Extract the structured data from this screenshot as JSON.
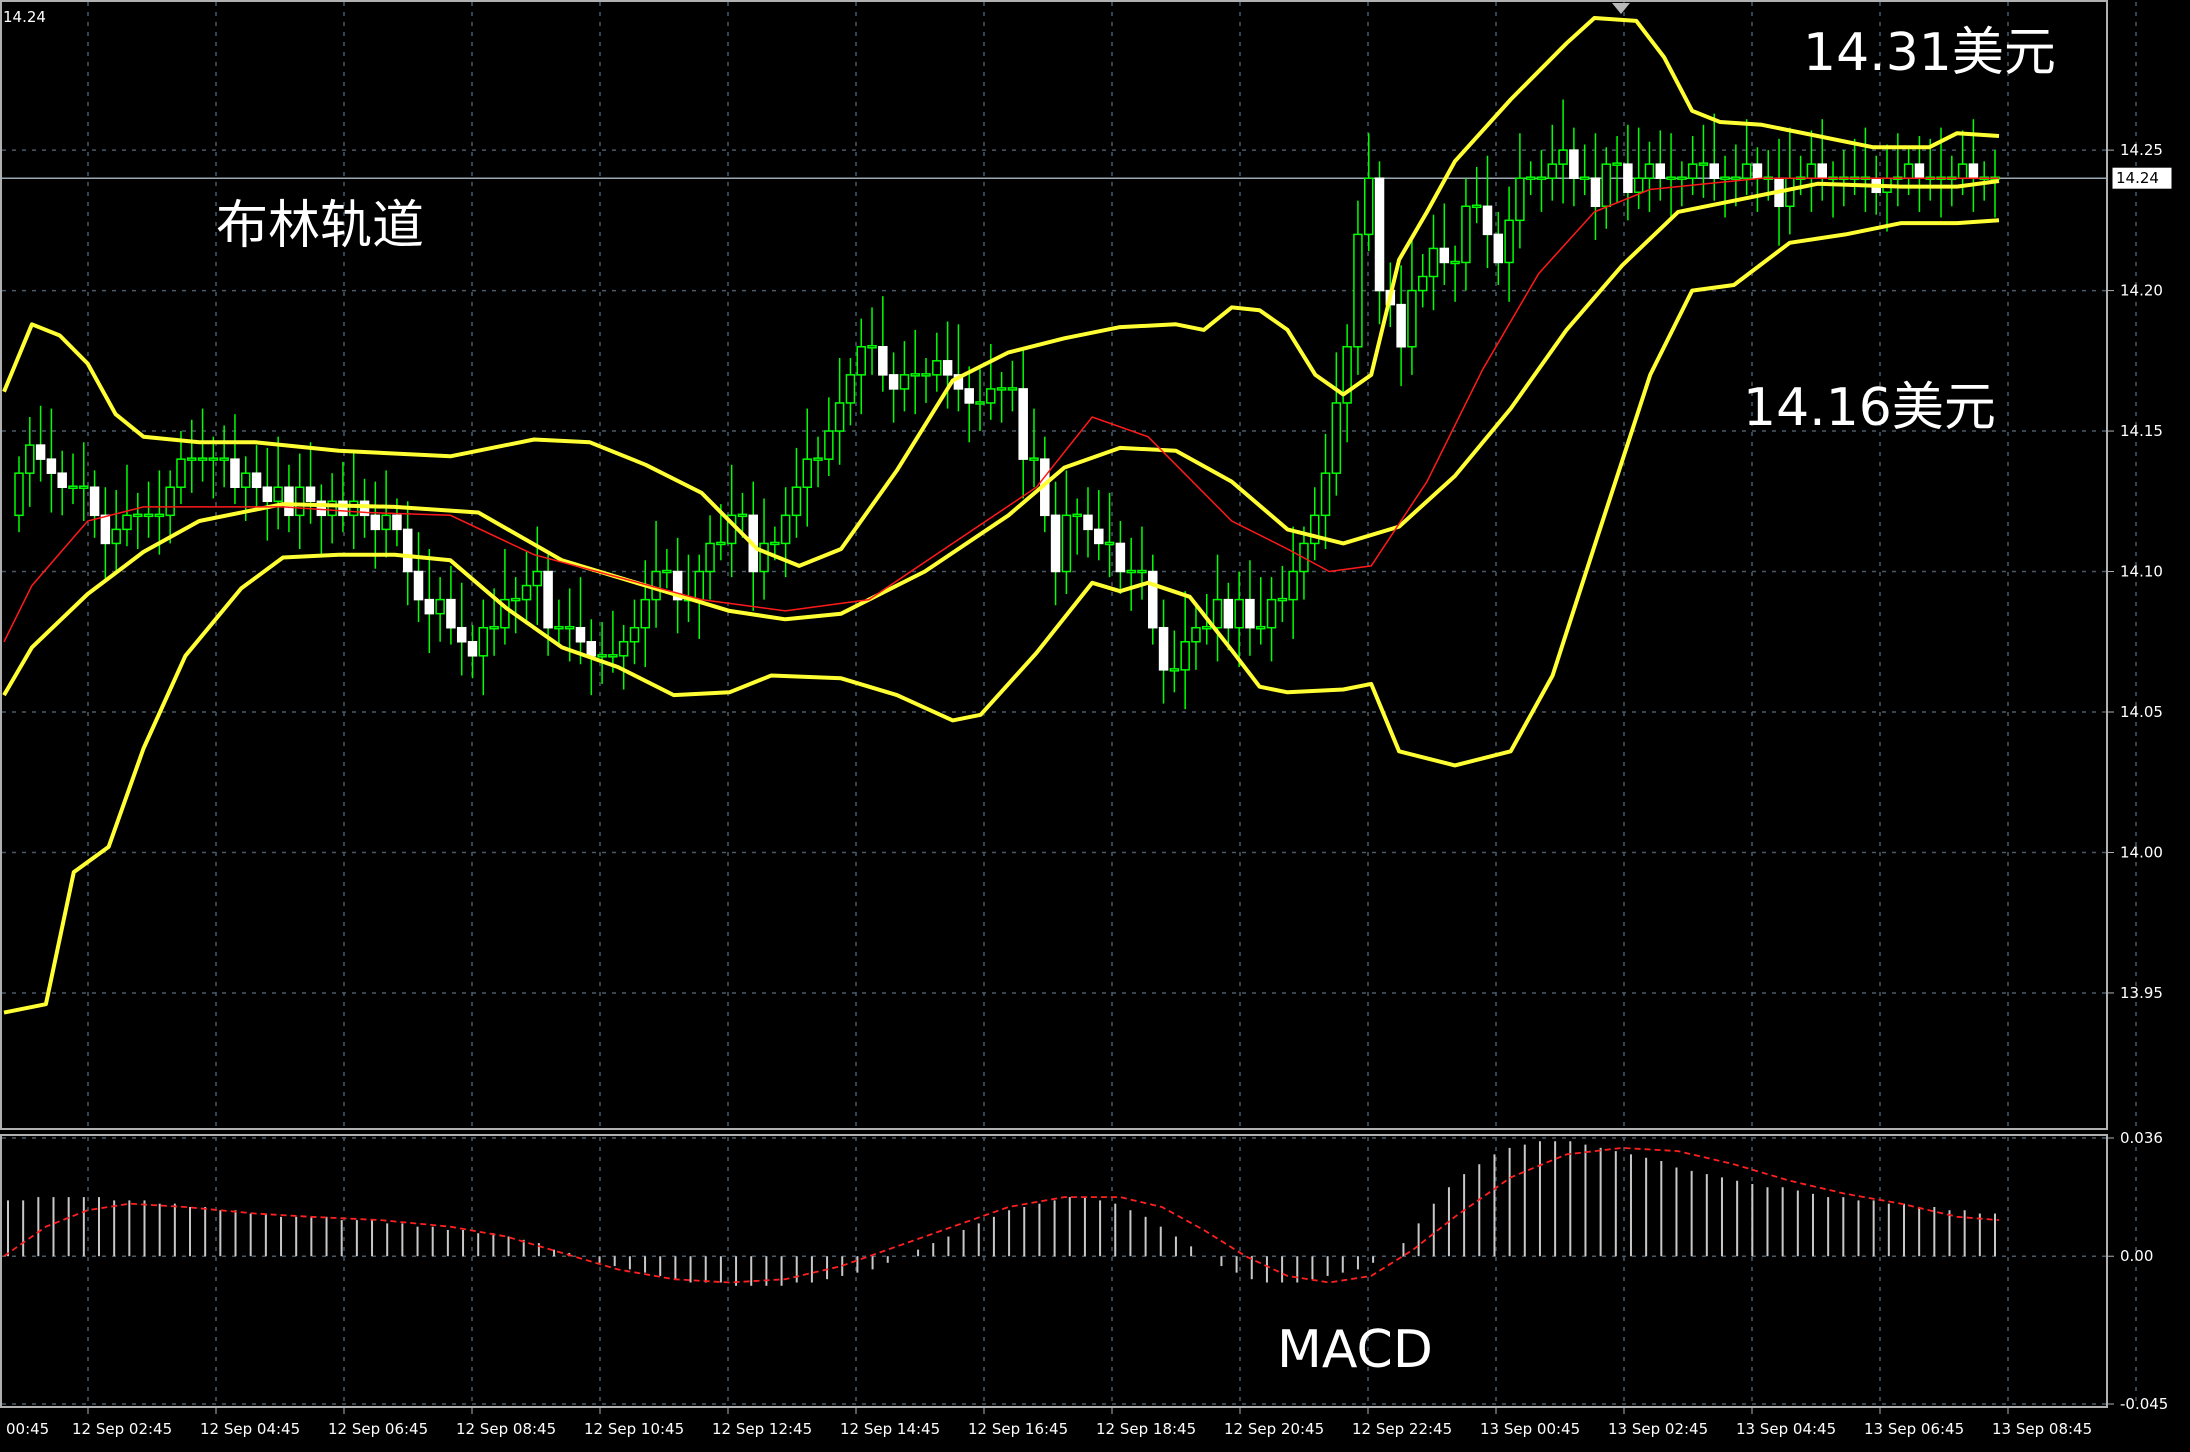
{
  "window": {
    "price_pane_title": "14.24",
    "annotations": {
      "indicator_label": "布林轨道",
      "upper_level": "14.31美元",
      "lower_level": "14.16美元",
      "macd_label": "MACD"
    }
  },
  "colors": {
    "background": "#000000",
    "grid": "#4a5a68",
    "frame": "#b0b0b0",
    "candle": "#00ff00",
    "bollinger": "#ffff33",
    "moving_average": "#ff1a1a",
    "macd_hist": "#c8c8c8",
    "macd_signal": "#ff2020",
    "current_price_line": "#9aa8b4"
  },
  "chart_data": [
    {
      "type": "candlestick",
      "indicator_overlays": [
        "Bollinger Bands",
        "Moving Average"
      ],
      "x_labels": [
        "00:45",
        "12 Sep 02:45",
        "12 Sep 04:45",
        "12 Sep 06:45",
        "12 Sep 08:45",
        "12 Sep 10:45",
        "12 Sep 12:45",
        "12 Sep 14:45",
        "12 Sep 16:45",
        "12 Sep 18:45",
        "12 Sep 20:45",
        "12 Sep 22:45",
        "13 Sep 00:45",
        "13 Sep 02:45",
        "13 Sep 04:45",
        "13 Sep 06:45",
        "13 Sep 08:45"
      ],
      "y_ticks": [
        "14.25",
        "14.20",
        "14.15",
        "14.10",
        "14.05",
        "14.00",
        "13.95"
      ],
      "ylim": [
        13.903,
        14.302
      ],
      "current_price": "14.24",
      "candles": {
        "close": [
          14.135,
          14.145,
          14.14,
          14.135,
          14.13,
          14.13,
          14.13,
          14.12,
          14.11,
          14.115,
          14.12,
          14.12,
          14.12,
          14.12,
          14.13,
          14.14,
          14.14,
          14.14,
          14.14,
          14.14,
          14.13,
          14.135,
          14.13,
          14.125,
          14.13,
          14.12,
          14.13,
          14.125,
          14.12,
          14.125,
          14.12,
          14.125,
          14.12,
          14.115,
          14.12,
          14.115,
          14.1,
          14.09,
          14.085,
          14.09,
          14.08,
          14.075,
          14.07,
          14.08,
          14.08,
          14.09,
          14.09,
          14.095,
          14.1,
          14.08,
          14.08,
          14.08,
          14.075,
          14.07,
          14.07,
          14.07,
          14.075,
          14.08,
          14.09,
          14.1,
          14.1,
          14.09,
          14.09,
          14.1,
          14.11,
          14.11,
          14.12,
          14.12,
          14.1,
          14.11,
          14.11,
          14.12,
          14.13,
          14.14,
          14.14,
          14.15,
          14.16,
          14.17,
          14.18,
          14.18,
          14.17,
          14.165,
          14.17,
          14.17,
          14.17,
          14.175,
          14.17,
          14.165,
          14.16,
          14.16,
          14.165,
          14.165,
          14.165,
          14.14,
          14.14,
          14.12,
          14.1,
          14.12,
          14.12,
          14.115,
          14.11,
          14.11,
          14.1,
          14.1,
          14.1,
          14.08,
          14.065,
          14.065,
          14.075,
          14.08,
          14.08,
          14.09,
          14.08,
          14.09,
          14.08,
          14.08,
          14.09,
          14.09,
          14.1,
          14.11,
          14.12,
          14.135,
          14.16,
          14.18,
          14.22,
          14.24,
          14.2,
          14.195,
          14.18,
          14.2,
          14.205,
          14.215,
          14.21,
          14.21,
          14.23,
          14.23,
          14.22,
          14.21,
          14.225,
          14.24,
          14.24,
          14.24,
          14.245,
          14.25,
          14.24,
          14.24,
          14.23,
          14.245,
          14.245,
          14.235,
          14.24,
          14.245,
          14.24,
          14.24,
          14.24,
          14.245,
          14.245,
          14.24,
          14.24,
          14.24,
          14.245,
          14.24,
          14.24,
          14.23,
          14.24,
          14.24,
          14.245,
          14.24,
          14.24,
          14.24,
          14.24,
          14.24,
          14.235,
          14.24,
          14.24,
          14.245,
          14.24,
          14.24,
          14.24,
          14.24,
          14.245,
          14.24,
          14.24,
          14.24
        ],
        "count": 184,
        "open_first": 14.12
      },
      "bollinger": {
        "upper_points": [
          [
            0,
            14.164
          ],
          [
            20,
            14.188
          ],
          [
            40,
            14.184
          ],
          [
            60,
            14.174
          ],
          [
            80,
            14.156
          ],
          [
            100,
            14.148
          ],
          [
            140,
            14.146
          ],
          [
            180,
            14.146
          ],
          [
            240,
            14.143
          ],
          [
            320,
            14.141
          ],
          [
            360,
            14.145
          ],
          [
            380,
            14.147
          ],
          [
            420,
            14.146
          ],
          [
            460,
            14.138
          ],
          [
            500,
            14.128
          ],
          [
            540,
            14.108
          ],
          [
            570,
            14.102
          ],
          [
            600,
            14.108
          ],
          [
            640,
            14.136
          ],
          [
            680,
            14.168
          ],
          [
            720,
            14.178
          ],
          [
            760,
            14.183
          ],
          [
            800,
            14.187
          ],
          [
            840,
            14.188
          ],
          [
            860,
            14.186
          ],
          [
            880,
            14.194
          ],
          [
            900,
            14.193
          ],
          [
            920,
            14.186
          ],
          [
            940,
            14.17
          ],
          [
            960,
            14.163
          ],
          [
            980,
            14.17
          ],
          [
            1000,
            14.211
          ],
          [
            1020,
            14.228
          ],
          [
            1040,
            14.246
          ],
          [
            1080,
            14.268
          ],
          [
            1120,
            14.288
          ],
          [
            1140,
            14.297
          ],
          [
            1170,
            14.296
          ],
          [
            1190,
            14.283
          ],
          [
            1210,
            14.264
          ],
          [
            1230,
            14.26
          ],
          [
            1260,
            14.259
          ],
          [
            1300,
            14.255
          ],
          [
            1340,
            14.251
          ],
          [
            1380,
            14.251
          ],
          [
            1400,
            14.256
          ],
          [
            1430,
            14.255
          ]
        ],
        "middle_points": [
          [
            0,
            14.056
          ],
          [
            20,
            14.073
          ],
          [
            60,
            14.092
          ],
          [
            100,
            14.107
          ],
          [
            140,
            14.118
          ],
          [
            200,
            14.124
          ],
          [
            280,
            14.123
          ],
          [
            340,
            14.121
          ],
          [
            400,
            14.104
          ],
          [
            460,
            14.095
          ],
          [
            520,
            14.086
          ],
          [
            560,
            14.083
          ],
          [
            600,
            14.085
          ],
          [
            660,
            14.1
          ],
          [
            720,
            14.12
          ],
          [
            760,
            14.137
          ],
          [
            800,
            14.144
          ],
          [
            840,
            14.143
          ],
          [
            880,
            14.132
          ],
          [
            920,
            14.115
          ],
          [
            960,
            14.11
          ],
          [
            1000,
            14.116
          ],
          [
            1040,
            14.134
          ],
          [
            1080,
            14.158
          ],
          [
            1120,
            14.186
          ],
          [
            1160,
            14.209
          ],
          [
            1200,
            14.228
          ],
          [
            1240,
            14.232
          ],
          [
            1300,
            14.238
          ],
          [
            1360,
            14.237
          ],
          [
            1400,
            14.237
          ],
          [
            1430,
            14.239
          ]
        ],
        "lower_points": [
          [
            0,
            13.943
          ],
          [
            30,
            13.946
          ],
          [
            50,
            13.993
          ],
          [
            75,
            14.002
          ],
          [
            100,
            14.037
          ],
          [
            130,
            14.07
          ],
          [
            170,
            14.094
          ],
          [
            200,
            14.105
          ],
          [
            240,
            14.106
          ],
          [
            280,
            14.106
          ],
          [
            320,
            14.104
          ],
          [
            360,
            14.087
          ],
          [
            400,
            14.073
          ],
          [
            440,
            14.066
          ],
          [
            480,
            14.056
          ],
          [
            520,
            14.057
          ],
          [
            550,
            14.063
          ],
          [
            600,
            14.062
          ],
          [
            640,
            14.056
          ],
          [
            680,
            14.047
          ],
          [
            700,
            14.049
          ],
          [
            740,
            14.071
          ],
          [
            780,
            14.096
          ],
          [
            800,
            14.093
          ],
          [
            820,
            14.096
          ],
          [
            850,
            14.091
          ],
          [
            880,
            14.072
          ],
          [
            900,
            14.059
          ],
          [
            920,
            14.057
          ],
          [
            960,
            14.058
          ],
          [
            980,
            14.06
          ],
          [
            1000,
            14.036
          ],
          [
            1040,
            14.031
          ],
          [
            1080,
            14.036
          ],
          [
            1110,
            14.063
          ],
          [
            1140,
            14.109
          ],
          [
            1180,
            14.17
          ],
          [
            1210,
            14.2
          ],
          [
            1240,
            14.202
          ],
          [
            1280,
            14.217
          ],
          [
            1320,
            14.22
          ],
          [
            1360,
            14.224
          ],
          [
            1400,
            14.224
          ],
          [
            1430,
            14.225
          ]
        ]
      },
      "moving_average": {
        "points": [
          [
            0,
            14.075
          ],
          [
            20,
            14.095
          ],
          [
            60,
            14.118
          ],
          [
            100,
            14.123
          ],
          [
            140,
            14.123
          ],
          [
            200,
            14.123
          ],
          [
            260,
            14.121
          ],
          [
            320,
            14.12
          ],
          [
            380,
            14.106
          ],
          [
            440,
            14.098
          ],
          [
            500,
            14.09
          ],
          [
            560,
            14.086
          ],
          [
            620,
            14.09
          ],
          [
            680,
            14.11
          ],
          [
            740,
            14.13
          ],
          [
            780,
            14.155
          ],
          [
            820,
            14.148
          ],
          [
            880,
            14.118
          ],
          [
            920,
            14.108
          ],
          [
            950,
            14.1
          ],
          [
            980,
            14.102
          ],
          [
            1020,
            14.132
          ],
          [
            1060,
            14.172
          ],
          [
            1100,
            14.206
          ],
          [
            1140,
            14.228
          ],
          [
            1180,
            14.236
          ],
          [
            1220,
            14.238
          ],
          [
            1260,
            14.24
          ],
          [
            1300,
            14.24
          ],
          [
            1360,
            14.24
          ],
          [
            1430,
            14.24
          ]
        ]
      }
    },
    {
      "type": "bar",
      "name": "MACD",
      "y_ticks": [
        "0.036",
        "0.00",
        "-0.045"
      ],
      "ylim": [
        -0.045,
        0.036
      ],
      "histogram": [
        0.017,
        0.017,
        0.018,
        0.018,
        0.018,
        0.018,
        0.018,
        0.017,
        0.017,
        0.017,
        0.016,
        0.016,
        0.015,
        0.015,
        0.014,
        0.014,
        0.013,
        0.013,
        0.012,
        0.012,
        0.012,
        0.012,
        0.011,
        0.011,
        0.011,
        0.01,
        0.01,
        0.009,
        0.009,
        0.008,
        0.008,
        0.007,
        0.007,
        0.006,
        0.005,
        0.004,
        0.002,
        0.001,
        0.0,
        -0.002,
        -0.003,
        -0.004,
        -0.005,
        -0.006,
        -0.007,
        -0.008,
        -0.008,
        -0.008,
        -0.009,
        -0.009,
        -0.009,
        -0.009,
        -0.008,
        -0.008,
        -0.007,
        -0.006,
        -0.005,
        -0.004,
        -0.002,
        0.0,
        0.002,
        0.004,
        0.006,
        0.008,
        0.01,
        0.012,
        0.014,
        0.015,
        0.016,
        0.017,
        0.018,
        0.018,
        0.017,
        0.016,
        0.014,
        0.012,
        0.009,
        0.006,
        0.003,
        0.0,
        -0.003,
        -0.005,
        -0.007,
        -0.008,
        -0.008,
        -0.008,
        -0.007,
        -0.006,
        -0.005,
        -0.004,
        -0.002,
        0.0,
        0.004,
        0.01,
        0.016,
        0.021,
        0.025,
        0.028,
        0.031,
        0.033,
        0.034,
        0.035,
        0.035,
        0.035,
        0.034,
        0.033,
        0.032,
        0.031,
        0.03,
        0.029,
        0.027,
        0.026,
        0.025,
        0.024,
        0.023,
        0.022,
        0.021,
        0.021,
        0.02,
        0.019,
        0.018,
        0.018,
        0.017,
        0.017,
        0.016,
        0.016,
        0.015,
        0.015,
        0.014,
        0.014,
        0.013,
        0.013
      ],
      "signal_points": [
        [
          0,
          0.0
        ],
        [
          30,
          0.009
        ],
        [
          60,
          0.014
        ],
        [
          90,
          0.016
        ],
        [
          130,
          0.015
        ],
        [
          180,
          0.013
        ],
        [
          220,
          0.012
        ],
        [
          270,
          0.011
        ],
        [
          320,
          0.009
        ],
        [
          360,
          0.006
        ],
        [
          400,
          0.001
        ],
        [
          440,
          -0.004
        ],
        [
          480,
          -0.007
        ],
        [
          520,
          -0.008
        ],
        [
          560,
          -0.007
        ],
        [
          600,
          -0.003
        ],
        [
          640,
          0.003
        ],
        [
          680,
          0.009
        ],
        [
          720,
          0.015
        ],
        [
          760,
          0.018
        ],
        [
          800,
          0.018
        ],
        [
          830,
          0.015
        ],
        [
          860,
          0.008
        ],
        [
          890,
          0.0
        ],
        [
          920,
          -0.006
        ],
        [
          950,
          -0.008
        ],
        [
          980,
          -0.006
        ],
        [
          1010,
          0.002
        ],
        [
          1040,
          0.012
        ],
        [
          1080,
          0.024
        ],
        [
          1120,
          0.031
        ],
        [
          1160,
          0.033
        ],
        [
          1200,
          0.032
        ],
        [
          1240,
          0.028
        ],
        [
          1280,
          0.023
        ],
        [
          1320,
          0.019
        ],
        [
          1360,
          0.016
        ],
        [
          1400,
          0.012
        ],
        [
          1430,
          0.011
        ]
      ]
    }
  ]
}
